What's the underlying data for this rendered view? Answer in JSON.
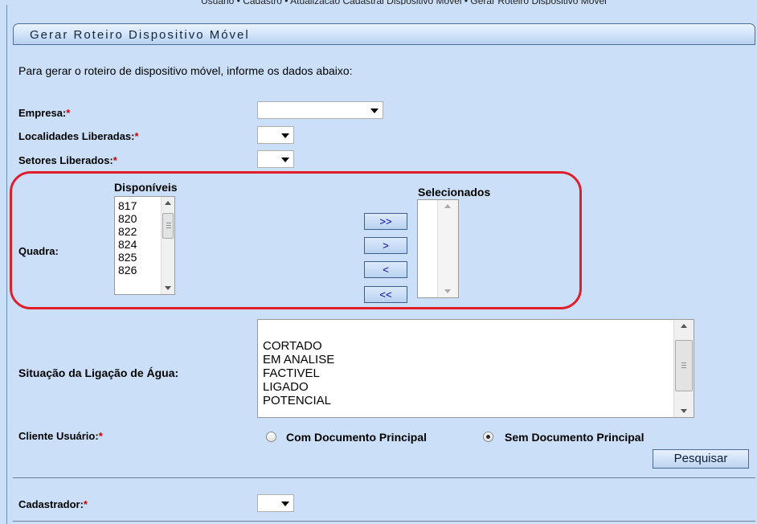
{
  "breadcrumb": "Usuario • Cadastro • Atualizacao Cadastral Dispositivo Movel • Gerar Roteiro Dispositivo Movel",
  "panel_title": "Gerar Roteiro Dispositivo Móvel",
  "intro": "Para gerar o roteiro de dispositivo móvel, informe os dados abaixo:",
  "required_mark": "*",
  "fields": {
    "empresa_label": "Empresa:",
    "localidades_label": "Localidades Liberadas:",
    "setores_label": "Setores Liberados:",
    "quadra_label": "Quadra:",
    "situacao_label": "Situação da Ligação de Água:",
    "cliente_label": "Cliente Usuário:",
    "cadastrador_label": "Cadastrador:"
  },
  "quadra": {
    "disponiveis_label": "Disponíveis",
    "selecionados_label": "Selecionados",
    "disponiveis": [
      "817",
      "820",
      "822",
      "824",
      "825",
      "826"
    ],
    "buttons": [
      ">>",
      ">",
      "<",
      "<<"
    ]
  },
  "situacao_options": [
    "CORTADO",
    "EM ANALISE",
    "FACTIVEL",
    "LIGADO",
    "POTENCIAL"
  ],
  "cliente_options": {
    "com": "Com Documento Principal",
    "sem": "Sem Documento Principal",
    "selected": "sem"
  },
  "pesquisar": "Pesquisar",
  "colors": {
    "background": "#cbe0f8",
    "highlight": "#e01e2c",
    "required": "#d00000"
  }
}
